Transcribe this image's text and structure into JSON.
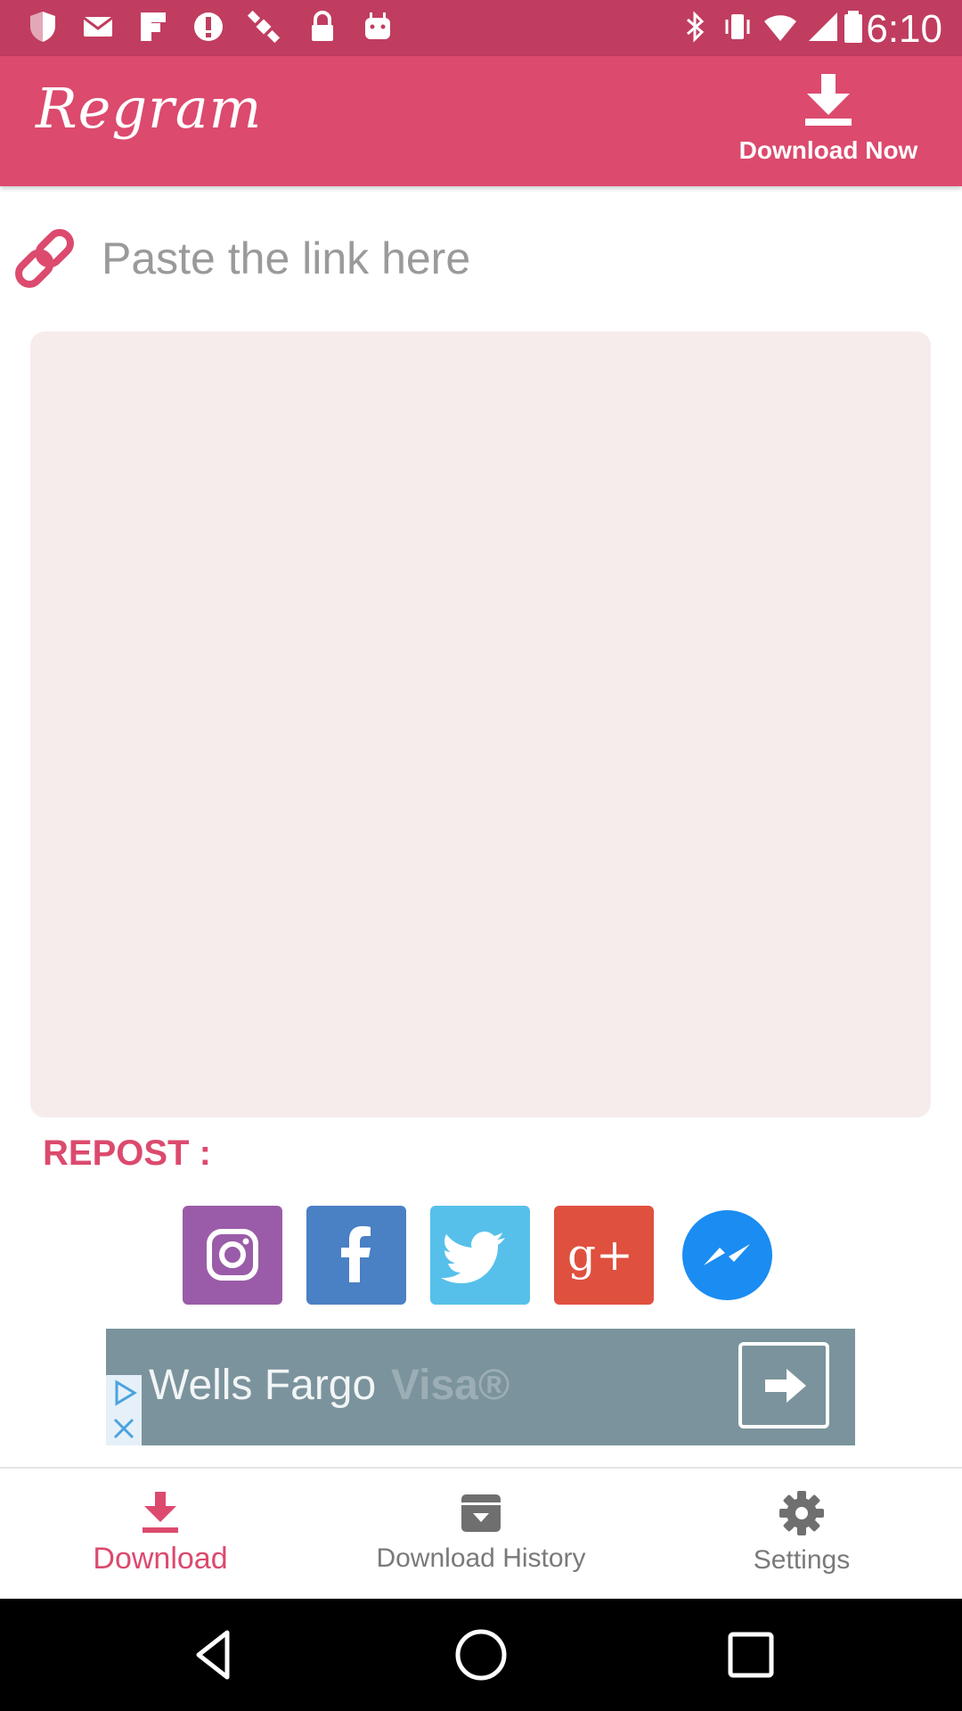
{
  "status_bar": {
    "time": "6:10",
    "left_icons": [
      "shield-icon",
      "mail-icon",
      "flipboard-icon",
      "alert-icon",
      "satellite-icon",
      "lock-icon",
      "android-icon"
    ],
    "right_icons": [
      "bluetooth-icon",
      "vibrate-icon",
      "wifi-icon",
      "signal-icon",
      "battery-icon"
    ]
  },
  "app_bar": {
    "logo": "Regram",
    "download_now_label": "Download Now",
    "background": "#dc4a6e"
  },
  "link_input": {
    "placeholder": "Paste the link here",
    "value": ""
  },
  "repost": {
    "label": "REPOST :",
    "targets": [
      {
        "name": "instagram",
        "color": "#9a5ca8"
      },
      {
        "name": "facebook",
        "color": "#4a80c4"
      },
      {
        "name": "twitter",
        "color": "#56c0ea"
      },
      {
        "name": "google-plus",
        "color": "#e0503f"
      },
      {
        "name": "messenger",
        "color": "#1b8cf2"
      }
    ]
  },
  "ad": {
    "text": "Wells Fargo",
    "ghost_text": "Visa®"
  },
  "bottom_nav": {
    "items": [
      {
        "label": "Download",
        "icon": "download-icon",
        "active": true
      },
      {
        "label": "Download History",
        "icon": "archive-icon",
        "active": false
      },
      {
        "label": "Settings",
        "icon": "gear-icon",
        "active": false
      }
    ]
  },
  "colors": {
    "accent": "#dc4a6e",
    "status_bar": "#c03d5f",
    "preview_background": "#f7ecec"
  }
}
